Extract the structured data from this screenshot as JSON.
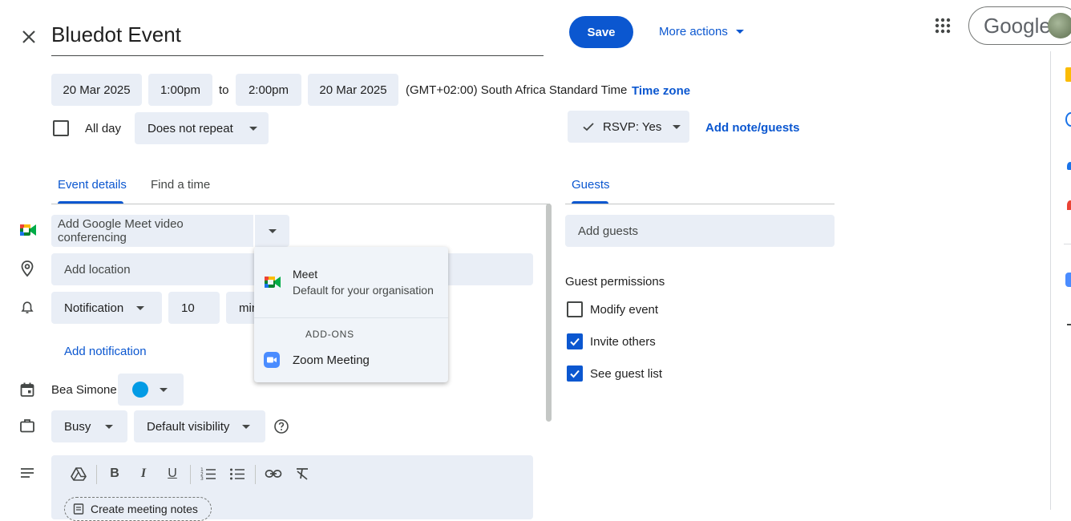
{
  "header": {
    "title": "Bluedot Event",
    "save_label": "Save",
    "more_actions_label": "More actions",
    "google_label": "Google"
  },
  "datetime": {
    "start_date": "20 Mar 2025",
    "start_time": "1:00pm",
    "to_label": "to",
    "end_time": "2:00pm",
    "end_date": "20 Mar 2025",
    "timezone_text": "(GMT+02:00) South Africa Standard Time",
    "timezone_link": "Time zone",
    "all_day_label": "All day",
    "repeat_value": "Does not repeat"
  },
  "rsvp": {
    "value": "RSVP: Yes",
    "add_note_label": "Add note/guests"
  },
  "tabs": [
    {
      "label": "Event details",
      "active": true
    },
    {
      "label": "Find a time",
      "active": false
    }
  ],
  "details": {
    "conferencing_placeholder": "Add Google Meet video conferencing",
    "location_placeholder": "Add location",
    "notification_type": "Notification",
    "notification_value": "10",
    "notification_unit": "minutes",
    "add_notification_label": "Add notification",
    "calendar_owner": "Bea Simone",
    "calendar_color": "#039be5",
    "busy_value": "Busy",
    "visibility_value": "Default visibility",
    "create_notes_label": "Create meeting notes"
  },
  "conferencing_menu": {
    "meet_title": "Meet",
    "meet_subtitle": "Default for your organisation",
    "addons_header": "ADD-ONS",
    "zoom_label": "Zoom Meeting"
  },
  "guests": {
    "tab_label": "Guests",
    "add_guests_placeholder": "Add guests",
    "permissions_title": "Guest permissions",
    "permissions": [
      {
        "label": "Modify event",
        "checked": false
      },
      {
        "label": "Invite others",
        "checked": true
      },
      {
        "label": "See guest list",
        "checked": true
      }
    ]
  },
  "colors": {
    "accent": "#0b57d0",
    "chip_bg": "#e9eef6"
  }
}
